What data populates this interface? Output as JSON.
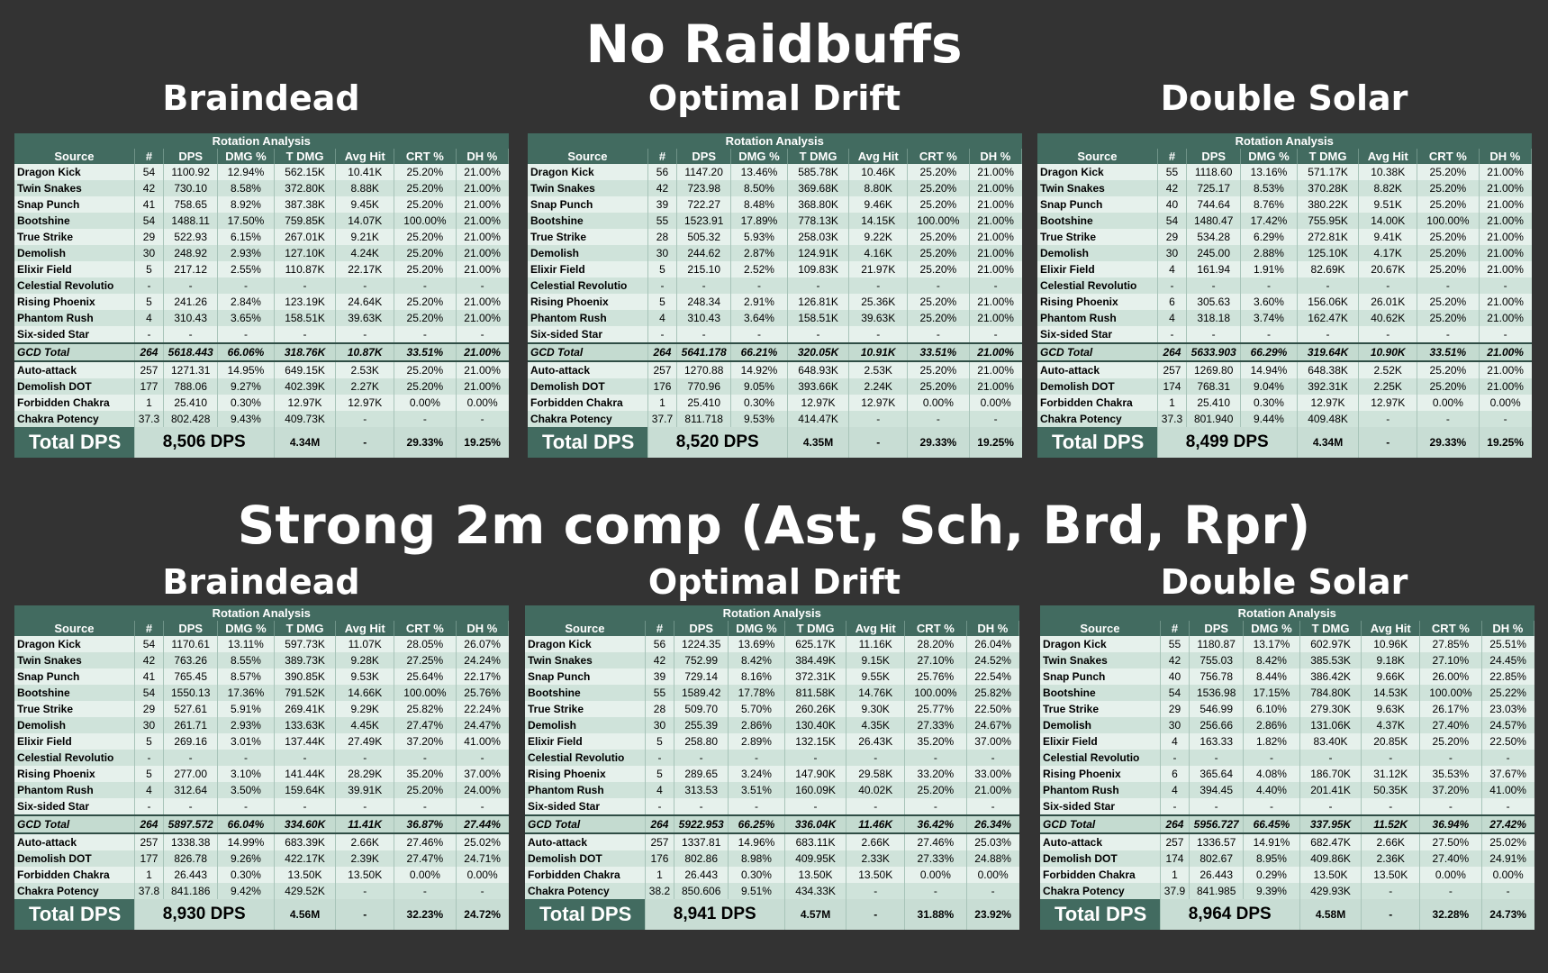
{
  "section_titles": [
    "No Raidbuffs",
    "Strong 2m comp (Ast, Sch, Brd, Rpr)"
  ],
  "table_caption": "Rotation Analysis",
  "table_headers": [
    "Source",
    "#",
    "DPS",
    "DMG %",
    "T DMG",
    "Avg Hit",
    "CRT %",
    "DH %"
  ],
  "total_label": "Total DPS",
  "panels": [
    {
      "title": "Braindead",
      "rows": [
        [
          "Dragon Kick",
          "54",
          "1100.92",
          "12.94%",
          "562.15K",
          "10.41K",
          "25.20%",
          "21.00%"
        ],
        [
          "Twin Snakes",
          "42",
          "730.10",
          "8.58%",
          "372.80K",
          "8.88K",
          "25.20%",
          "21.00%"
        ],
        [
          "Snap Punch",
          "41",
          "758.65",
          "8.92%",
          "387.38K",
          "9.45K",
          "25.20%",
          "21.00%"
        ],
        [
          "Bootshine",
          "54",
          "1488.11",
          "17.50%",
          "759.85K",
          "14.07K",
          "100.00%",
          "21.00%"
        ],
        [
          "True Strike",
          "29",
          "522.93",
          "6.15%",
          "267.01K",
          "9.21K",
          "25.20%",
          "21.00%"
        ],
        [
          "Demolish",
          "30",
          "248.92",
          "2.93%",
          "127.10K",
          "4.24K",
          "25.20%",
          "21.00%"
        ],
        [
          "Elixir Field",
          "5",
          "217.12",
          "2.55%",
          "110.87K",
          "22.17K",
          "25.20%",
          "21.00%"
        ],
        [
          "Celestial Revolutio",
          "-",
          "-",
          "-",
          "-",
          "-",
          "-",
          "-"
        ],
        [
          "Rising Phoenix",
          "5",
          "241.26",
          "2.84%",
          "123.19K",
          "24.64K",
          "25.20%",
          "21.00%"
        ],
        [
          "Phantom Rush",
          "4",
          "310.43",
          "3.65%",
          "158.51K",
          "39.63K",
          "25.20%",
          "21.00%"
        ],
        [
          "Six-sided Star",
          "-",
          "-",
          "-",
          "-",
          "-",
          "-",
          "-"
        ]
      ],
      "gcd": [
        "GCD Total",
        "264",
        "5618.443",
        "66.06%",
        "318.76K",
        "10.87K",
        "33.51%",
        "21.00%"
      ],
      "extra_rows": [
        [
          "Auto-attack",
          "257",
          "1271.31",
          "14.95%",
          "649.15K",
          "2.53K",
          "25.20%",
          "21.00%"
        ],
        [
          "Demolish DOT",
          "177",
          "788.06",
          "9.27%",
          "402.39K",
          "2.27K",
          "25.20%",
          "21.00%"
        ],
        [
          "Forbidden Chakra",
          "1",
          "25.410",
          "0.30%",
          "12.97K",
          "12.97K",
          "0.00%",
          "0.00%"
        ],
        [
          "Chakra Potency",
          "37.3",
          "802.428",
          "9.43%",
          "409.73K",
          "-",
          "-",
          "-"
        ]
      ],
      "total": [
        "8,506 DPS",
        "4.34M",
        "-",
        "29.33%",
        "19.25%"
      ]
    },
    {
      "title": "Optimal Drift",
      "rows": [
        [
          "Dragon Kick",
          "56",
          "1147.20",
          "13.46%",
          "585.78K",
          "10.46K",
          "25.20%",
          "21.00%"
        ],
        [
          "Twin Snakes",
          "42",
          "723.98",
          "8.50%",
          "369.68K",
          "8.80K",
          "25.20%",
          "21.00%"
        ],
        [
          "Snap Punch",
          "39",
          "722.27",
          "8.48%",
          "368.80K",
          "9.46K",
          "25.20%",
          "21.00%"
        ],
        [
          "Bootshine",
          "55",
          "1523.91",
          "17.89%",
          "778.13K",
          "14.15K",
          "100.00%",
          "21.00%"
        ],
        [
          "True Strike",
          "28",
          "505.32",
          "5.93%",
          "258.03K",
          "9.22K",
          "25.20%",
          "21.00%"
        ],
        [
          "Demolish",
          "30",
          "244.62",
          "2.87%",
          "124.91K",
          "4.16K",
          "25.20%",
          "21.00%"
        ],
        [
          "Elixir Field",
          "5",
          "215.10",
          "2.52%",
          "109.83K",
          "21.97K",
          "25.20%",
          "21.00%"
        ],
        [
          "Celestial Revolutio",
          "-",
          "-",
          "-",
          "-",
          "-",
          "-",
          "-"
        ],
        [
          "Rising Phoenix",
          "5",
          "248.34",
          "2.91%",
          "126.81K",
          "25.36K",
          "25.20%",
          "21.00%"
        ],
        [
          "Phantom Rush",
          "4",
          "310.43",
          "3.64%",
          "158.51K",
          "39.63K",
          "25.20%",
          "21.00%"
        ],
        [
          "Six-sided Star",
          "-",
          "-",
          "-",
          "-",
          "-",
          "-",
          "-"
        ]
      ],
      "gcd": [
        "GCD Total",
        "264",
        "5641.178",
        "66.21%",
        "320.05K",
        "10.91K",
        "33.51%",
        "21.00%"
      ],
      "extra_rows": [
        [
          "Auto-attack",
          "257",
          "1270.88",
          "14.92%",
          "648.93K",
          "2.53K",
          "25.20%",
          "21.00%"
        ],
        [
          "Demolish DOT",
          "176",
          "770.96",
          "9.05%",
          "393.66K",
          "2.24K",
          "25.20%",
          "21.00%"
        ],
        [
          "Forbidden Chakra",
          "1",
          "25.410",
          "0.30%",
          "12.97K",
          "12.97K",
          "0.00%",
          "0.00%"
        ],
        [
          "Chakra Potency",
          "37.7",
          "811.718",
          "9.53%",
          "414.47K",
          "-",
          "-",
          "-"
        ]
      ],
      "total": [
        "8,520 DPS",
        "4.35M",
        "-",
        "29.33%",
        "19.25%"
      ]
    },
    {
      "title": "Double Solar",
      "rows": [
        [
          "Dragon Kick",
          "55",
          "1118.60",
          "13.16%",
          "571.17K",
          "10.38K",
          "25.20%",
          "21.00%"
        ],
        [
          "Twin Snakes",
          "42",
          "725.17",
          "8.53%",
          "370.28K",
          "8.82K",
          "25.20%",
          "21.00%"
        ],
        [
          "Snap Punch",
          "40",
          "744.64",
          "8.76%",
          "380.22K",
          "9.51K",
          "25.20%",
          "21.00%"
        ],
        [
          "Bootshine",
          "54",
          "1480.47",
          "17.42%",
          "755.95K",
          "14.00K",
          "100.00%",
          "21.00%"
        ],
        [
          "True Strike",
          "29",
          "534.28",
          "6.29%",
          "272.81K",
          "9.41K",
          "25.20%",
          "21.00%"
        ],
        [
          "Demolish",
          "30",
          "245.00",
          "2.88%",
          "125.10K",
          "4.17K",
          "25.20%",
          "21.00%"
        ],
        [
          "Elixir Field",
          "4",
          "161.94",
          "1.91%",
          "82.69K",
          "20.67K",
          "25.20%",
          "21.00%"
        ],
        [
          "Celestial Revolutio",
          "-",
          "-",
          "-",
          "-",
          "-",
          "-",
          "-"
        ],
        [
          "Rising Phoenix",
          "6",
          "305.63",
          "3.60%",
          "156.06K",
          "26.01K",
          "25.20%",
          "21.00%"
        ],
        [
          "Phantom Rush",
          "4",
          "318.18",
          "3.74%",
          "162.47K",
          "40.62K",
          "25.20%",
          "21.00%"
        ],
        [
          "Six-sided Star",
          "-",
          "-",
          "-",
          "-",
          "-",
          "-",
          "-"
        ]
      ],
      "gcd": [
        "GCD Total",
        "264",
        "5633.903",
        "66.29%",
        "319.64K",
        "10.90K",
        "33.51%",
        "21.00%"
      ],
      "extra_rows": [
        [
          "Auto-attack",
          "257",
          "1269.80",
          "14.94%",
          "648.38K",
          "2.52K",
          "25.20%",
          "21.00%"
        ],
        [
          "Demolish DOT",
          "174",
          "768.31",
          "9.04%",
          "392.31K",
          "2.25K",
          "25.20%",
          "21.00%"
        ],
        [
          "Forbidden Chakra",
          "1",
          "25.410",
          "0.30%",
          "12.97K",
          "12.97K",
          "0.00%",
          "0.00%"
        ],
        [
          "Chakra Potency",
          "37.3",
          "801.940",
          "9.44%",
          "409.48K",
          "-",
          "-",
          "-"
        ]
      ],
      "total": [
        "8,499 DPS",
        "4.34M",
        "-",
        "29.33%",
        "19.25%"
      ]
    },
    {
      "title": "Braindead",
      "rows": [
        [
          "Dragon Kick",
          "54",
          "1170.61",
          "13.11%",
          "597.73K",
          "11.07K",
          "28.05%",
          "26.07%"
        ],
        [
          "Twin Snakes",
          "42",
          "763.26",
          "8.55%",
          "389.73K",
          "9.28K",
          "27.25%",
          "24.24%"
        ],
        [
          "Snap Punch",
          "41",
          "765.45",
          "8.57%",
          "390.85K",
          "9.53K",
          "25.64%",
          "22.17%"
        ],
        [
          "Bootshine",
          "54",
          "1550.13",
          "17.36%",
          "791.52K",
          "14.66K",
          "100.00%",
          "25.76%"
        ],
        [
          "True Strike",
          "29",
          "527.61",
          "5.91%",
          "269.41K",
          "9.29K",
          "25.82%",
          "22.24%"
        ],
        [
          "Demolish",
          "30",
          "261.71",
          "2.93%",
          "133.63K",
          "4.45K",
          "27.47%",
          "24.47%"
        ],
        [
          "Elixir Field",
          "5",
          "269.16",
          "3.01%",
          "137.44K",
          "27.49K",
          "37.20%",
          "41.00%"
        ],
        [
          "Celestial Revolutio",
          "-",
          "-",
          "-",
          "-",
          "-",
          "-",
          "-"
        ],
        [
          "Rising Phoenix",
          "5",
          "277.00",
          "3.10%",
          "141.44K",
          "28.29K",
          "35.20%",
          "37.00%"
        ],
        [
          "Phantom Rush",
          "4",
          "312.64",
          "3.50%",
          "159.64K",
          "39.91K",
          "25.20%",
          "24.00%"
        ],
        [
          "Six-sided Star",
          "-",
          "-",
          "-",
          "-",
          "-",
          "-",
          "-"
        ]
      ],
      "gcd": [
        "GCD Total",
        "264",
        "5897.572",
        "66.04%",
        "334.60K",
        "11.41K",
        "36.87%",
        "27.44%"
      ],
      "extra_rows": [
        [
          "Auto-attack",
          "257",
          "1338.38",
          "14.99%",
          "683.39K",
          "2.66K",
          "27.46%",
          "25.02%"
        ],
        [
          "Demolish DOT",
          "177",
          "826.78",
          "9.26%",
          "422.17K",
          "2.39K",
          "27.47%",
          "24.71%"
        ],
        [
          "Forbidden Chakra",
          "1",
          "26.443",
          "0.30%",
          "13.50K",
          "13.50K",
          "0.00%",
          "0.00%"
        ],
        [
          "Chakra Potency",
          "37.8",
          "841.186",
          "9.42%",
          "429.52K",
          "-",
          "-",
          "-"
        ]
      ],
      "total": [
        "8,930 DPS",
        "4.56M",
        "-",
        "32.23%",
        "24.72%"
      ]
    },
    {
      "title": "Optimal Drift",
      "rows": [
        [
          "Dragon Kick",
          "56",
          "1224.35",
          "13.69%",
          "625.17K",
          "11.16K",
          "28.20%",
          "26.04%"
        ],
        [
          "Twin Snakes",
          "42",
          "752.99",
          "8.42%",
          "384.49K",
          "9.15K",
          "27.10%",
          "24.52%"
        ],
        [
          "Snap Punch",
          "39",
          "729.14",
          "8.16%",
          "372.31K",
          "9.55K",
          "25.76%",
          "22.54%"
        ],
        [
          "Bootshine",
          "55",
          "1589.42",
          "17.78%",
          "811.58K",
          "14.76K",
          "100.00%",
          "25.82%"
        ],
        [
          "True Strike",
          "28",
          "509.70",
          "5.70%",
          "260.26K",
          "9.30K",
          "25.77%",
          "22.50%"
        ],
        [
          "Demolish",
          "30",
          "255.39",
          "2.86%",
          "130.40K",
          "4.35K",
          "27.33%",
          "24.67%"
        ],
        [
          "Elixir Field",
          "5",
          "258.80",
          "2.89%",
          "132.15K",
          "26.43K",
          "35.20%",
          "37.00%"
        ],
        [
          "Celestial Revolutio",
          "-",
          "-",
          "-",
          "-",
          "-",
          "-",
          "-"
        ],
        [
          "Rising Phoenix",
          "5",
          "289.65",
          "3.24%",
          "147.90K",
          "29.58K",
          "33.20%",
          "33.00%"
        ],
        [
          "Phantom Rush",
          "4",
          "313.53",
          "3.51%",
          "160.09K",
          "40.02K",
          "25.20%",
          "21.00%"
        ],
        [
          "Six-sided Star",
          "-",
          "-",
          "-",
          "-",
          "-",
          "-",
          "-"
        ]
      ],
      "gcd": [
        "GCD Total",
        "264",
        "5922.953",
        "66.25%",
        "336.04K",
        "11.46K",
        "36.42%",
        "26.34%"
      ],
      "extra_rows": [
        [
          "Auto-attack",
          "257",
          "1337.81",
          "14.96%",
          "683.11K",
          "2.66K",
          "27.46%",
          "25.03%"
        ],
        [
          "Demolish DOT",
          "176",
          "802.86",
          "8.98%",
          "409.95K",
          "2.33K",
          "27.33%",
          "24.88%"
        ],
        [
          "Forbidden Chakra",
          "1",
          "26.443",
          "0.30%",
          "13.50K",
          "13.50K",
          "0.00%",
          "0.00%"
        ],
        [
          "Chakra Potency",
          "38.2",
          "850.606",
          "9.51%",
          "434.33K",
          "-",
          "-",
          "-"
        ]
      ],
      "total": [
        "8,941 DPS",
        "4.57M",
        "-",
        "31.88%",
        "23.92%"
      ]
    },
    {
      "title": "Double Solar",
      "rows": [
        [
          "Dragon Kick",
          "55",
          "1180.87",
          "13.17%",
          "602.97K",
          "10.96K",
          "27.85%",
          "25.51%"
        ],
        [
          "Twin Snakes",
          "42",
          "755.03",
          "8.42%",
          "385.53K",
          "9.18K",
          "27.10%",
          "24.45%"
        ],
        [
          "Snap Punch",
          "40",
          "756.78",
          "8.44%",
          "386.42K",
          "9.66K",
          "26.00%",
          "22.85%"
        ],
        [
          "Bootshine",
          "54",
          "1536.98",
          "17.15%",
          "784.80K",
          "14.53K",
          "100.00%",
          "25.22%"
        ],
        [
          "True Strike",
          "29",
          "546.99",
          "6.10%",
          "279.30K",
          "9.63K",
          "26.17%",
          "23.03%"
        ],
        [
          "Demolish",
          "30",
          "256.66",
          "2.86%",
          "131.06K",
          "4.37K",
          "27.40%",
          "24.57%"
        ],
        [
          "Elixir Field",
          "4",
          "163.33",
          "1.82%",
          "83.40K",
          "20.85K",
          "25.20%",
          "22.50%"
        ],
        [
          "Celestial Revolutio",
          "-",
          "-",
          "-",
          "-",
          "-",
          "-",
          "-"
        ],
        [
          "Rising Phoenix",
          "6",
          "365.64",
          "4.08%",
          "186.70K",
          "31.12K",
          "35.53%",
          "37.67%"
        ],
        [
          "Phantom Rush",
          "4",
          "394.45",
          "4.40%",
          "201.41K",
          "50.35K",
          "37.20%",
          "41.00%"
        ],
        [
          "Six-sided Star",
          "-",
          "-",
          "-",
          "-",
          "-",
          "-",
          "-"
        ]
      ],
      "gcd": [
        "GCD Total",
        "264",
        "5956.727",
        "66.45%",
        "337.95K",
        "11.52K",
        "36.94%",
        "27.42%"
      ],
      "extra_rows": [
        [
          "Auto-attack",
          "257",
          "1336.57",
          "14.91%",
          "682.47K",
          "2.66K",
          "27.50%",
          "25.02%"
        ],
        [
          "Demolish DOT",
          "174",
          "802.67",
          "8.95%",
          "409.86K",
          "2.36K",
          "27.40%",
          "24.91%"
        ],
        [
          "Forbidden Chakra",
          "1",
          "26.443",
          "0.29%",
          "13.50K",
          "13.50K",
          "0.00%",
          "0.00%"
        ],
        [
          "Chakra Potency",
          "37.9",
          "841.985",
          "9.39%",
          "429.93K",
          "-",
          "-",
          "-"
        ]
      ],
      "total": [
        "8,964 DPS",
        "4.58M",
        "-",
        "32.28%",
        "24.73%"
      ]
    }
  ]
}
